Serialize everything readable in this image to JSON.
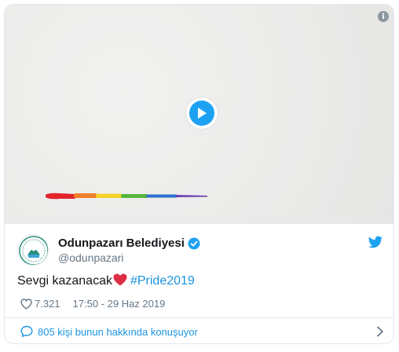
{
  "media": {
    "info_glyph": "i",
    "play_icon": "play-icon"
  },
  "author": {
    "name": "Odunpazarı Belediyesi",
    "handle": "@odunpazari",
    "verified_icon": "verified-badge-icon"
  },
  "tweet": {
    "text": "Sevgi kazanacak",
    "emoji": "red-heart",
    "hashtag": "#Pride2019",
    "likes": "7.321",
    "timestamp": "17:50 - 29 Haz 2019"
  },
  "footer": {
    "conversation_label": "805 kişi bunun hakkında konuşuyor"
  },
  "colors": {
    "brand_blue": "#1da1f2",
    "link_blue": "#1b95e0",
    "muted": "#657786",
    "border": "#e1e8ed",
    "heart_red": "#e0245e"
  }
}
